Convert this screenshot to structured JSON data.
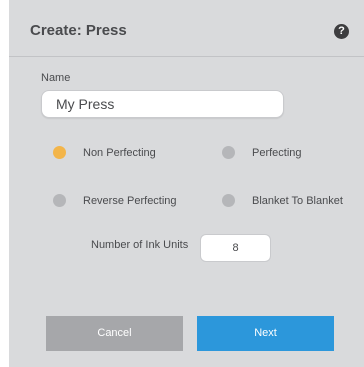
{
  "dialog": {
    "title": "Create: Press",
    "help_icon": "question-mark-icon",
    "help_glyph": "?"
  },
  "form": {
    "name_label": "Name",
    "name_value": "My Press",
    "press_types": [
      {
        "label": "Non Perfecting",
        "selected": true
      },
      {
        "label": "Perfecting",
        "selected": false
      },
      {
        "label": "Reverse Perfecting",
        "selected": false
      },
      {
        "label": "Blanket To Blanket",
        "selected": false
      }
    ],
    "ink_units_label": "Number of Ink Units",
    "ink_units_value": "8"
  },
  "buttons": {
    "cancel_label": "Cancel",
    "next_label": "Next"
  },
  "colors": {
    "background": "#d9dadc",
    "selected_radio": "#f3b54a",
    "unselected_radio": "#b5b6b9",
    "primary_button": "#2c97db",
    "cancel_button": "#a6a7aa"
  }
}
